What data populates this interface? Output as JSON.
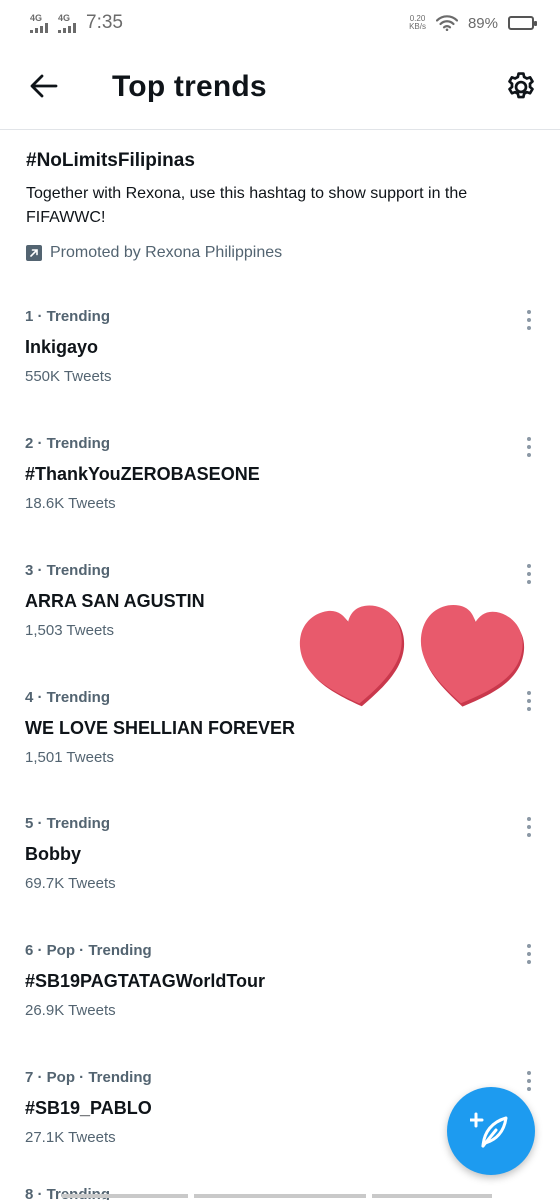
{
  "status_bar": {
    "sim1": "4G",
    "sim2": "4G",
    "time": "7:35",
    "net_speed_value": "0.20",
    "net_speed_unit": "KB/s",
    "battery": "89%",
    "battery_level": 0.89
  },
  "header": {
    "title": "Top trends"
  },
  "promo": {
    "hashtag": "#NoLimitsFilipinas",
    "description": "Together with Rexona, use this hashtag to show support in the FIFAWWC!",
    "promoted_by": "Promoted by Rexona Philippines"
  },
  "trends": [
    {
      "meta": "1 · Trending",
      "name": "Inkigayo",
      "count": "550K Tweets"
    },
    {
      "meta": "2 · Trending",
      "name": "#ThankYouZEROBASEONE",
      "count": "18.6K Tweets"
    },
    {
      "meta": "3 · Trending",
      "name": "ARRA SAN AGUSTIN",
      "count": "1,503 Tweets"
    },
    {
      "meta": "4 · Trending",
      "name": "WE LOVE SHELLIAN FOREVER",
      "count": "1,501 Tweets"
    },
    {
      "meta": "5 · Trending",
      "name": "Bobby",
      "count": "69.7K Tweets"
    },
    {
      "meta": "6 · Pop · Trending",
      "name": "#SB19PAGTATAGWorldTour",
      "count": "26.9K Tweets"
    },
    {
      "meta": "7 · Pop · Trending",
      "name": "#SB19_PABLO",
      "count": "27.1K Tweets"
    }
  ],
  "partial_trend": "8 · Trending",
  "colors": {
    "accent": "#1d9bf0",
    "heart": "#e85a6c",
    "secondary_text": "#536471",
    "primary_text": "#0f1419"
  },
  "icons": {
    "back": "arrow-left-icon",
    "settings": "gear-icon",
    "promoted": "promoted-arrow-icon",
    "more": "more-vertical-icon",
    "compose": "feather-plus-icon",
    "decoration": "heart-icon"
  }
}
